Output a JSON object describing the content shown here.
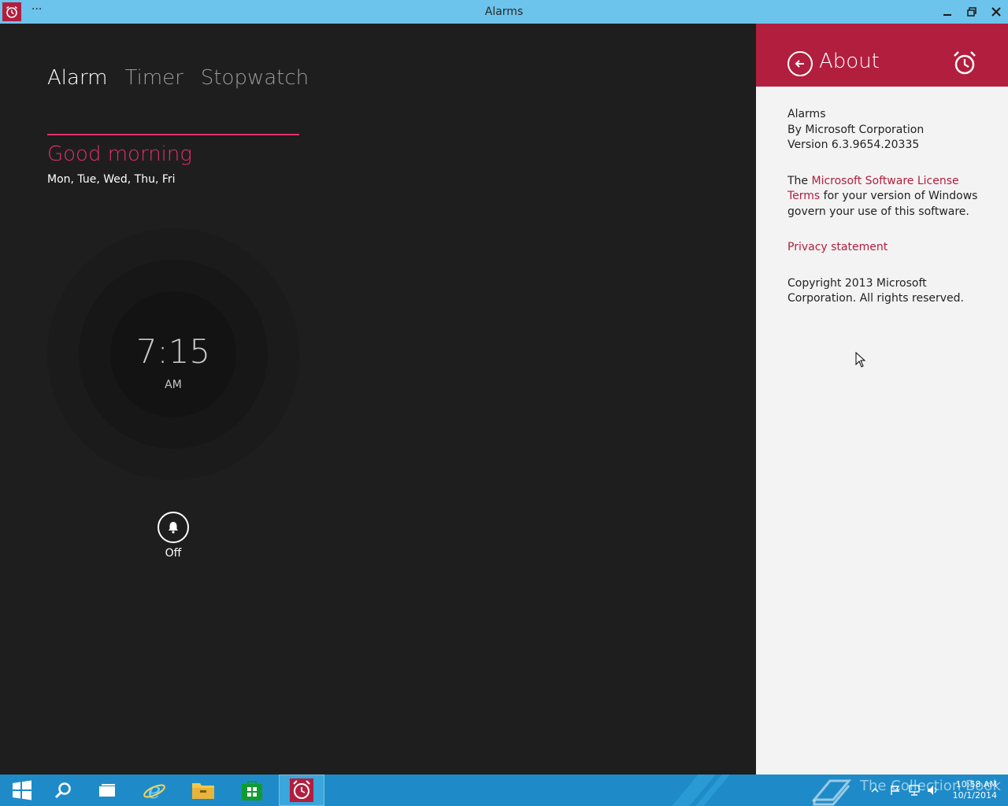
{
  "window": {
    "title": "Alarms",
    "more_label": "···"
  },
  "tabs": [
    {
      "label": "Alarm",
      "active": true
    },
    {
      "label": "Timer",
      "active": false
    },
    {
      "label": "Stopwatch",
      "active": false
    }
  ],
  "alarm": {
    "name": "Good morning",
    "days": "Mon, Tue, Wed, Thu, Fri",
    "time": "7:15",
    "ampm": "AM",
    "toggle_label": "Off"
  },
  "about": {
    "title": "About",
    "app_name": "Alarms",
    "publisher": "By Microsoft Corporation",
    "version": "Version 6.3.9654.20335",
    "license_prefix": "The ",
    "license_link": "Microsoft Software License Terms",
    "license_suffix": " for your version of Windows govern your use of this software.",
    "privacy_link": "Privacy statement",
    "copyright": "Copyright 2013 Microsoft Corporation. All rights reserved."
  },
  "taskbar": {
    "watermark": "The Collection Book",
    "time": "10:58 AM",
    "date": "10/1/2014"
  },
  "colors": {
    "accent": "#b21e3e",
    "alarm_pink": "#e0306f",
    "titlebar": "#6cc3ec",
    "taskbar": "#1e8bc8",
    "app_bg": "#1e1e1e",
    "flyout_bg": "#f3f3f3"
  }
}
